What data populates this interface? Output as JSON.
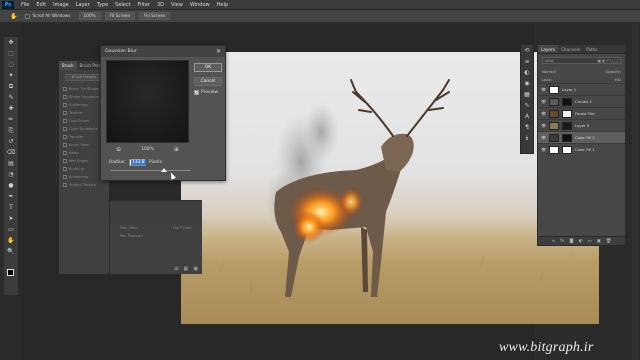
{
  "app": {
    "logo": "Ps"
  },
  "menu": [
    "File",
    "Edit",
    "Image",
    "Layer",
    "Type",
    "Select",
    "Filter",
    "3D",
    "View",
    "Window",
    "Help"
  ],
  "options": {
    "scroll_all_windows": "Scroll All Windows",
    "zoom_level": "100%",
    "fit_screen": "Fit Screen",
    "fill_screen": "Fill Screen"
  },
  "tools": [
    "move-tool-icon",
    "marquee-tool-icon",
    "lasso-tool-icon",
    "quick-select-icon",
    "crop-tool-icon",
    "eyedropper-icon",
    "healing-brush-icon",
    "brush-tool-icon",
    "clone-stamp-icon",
    "history-brush-icon",
    "eraser-icon",
    "gradient-icon",
    "blur-tool-icon",
    "dodge-tool-icon",
    "pen-tool-icon",
    "type-tool-icon",
    "path-select-icon",
    "shape-tool-icon",
    "hand-tool-icon",
    "zoom-tool-icon"
  ],
  "brush_panel": {
    "tabs": [
      "Brush",
      "Brush Pres"
    ],
    "presets_button": "Brush Presets",
    "items": [
      "Brush Tip Shape",
      "Shape Dynamics",
      "Scattering",
      "Texture",
      "Dual Brush",
      "Color Dynamics",
      "Transfer",
      "Brush Pose",
      "Noise",
      "Wet Edges",
      "Build-up",
      "Smoothing",
      "Protect Texture"
    ],
    "footer": {
      "left_top": "Size Jitter",
      "right_top": "Flip Y Jitter",
      "left_mid": "Pen Pressure",
      "right_mid": ""
    }
  },
  "gaussian_blur": {
    "title": "Gaussian Blur",
    "ok": "OK",
    "cancel": "Cancel",
    "preview_label": "Preview",
    "preview_checked": true,
    "zoom": "100%",
    "radius_label": "Radius:",
    "radius_value": "133.8",
    "radius_unit": "Pixels",
    "slider_fraction": 0.66
  },
  "layers_panel": {
    "tabs": [
      "Layers",
      "Channels",
      "Paths"
    ],
    "kind": "Kind",
    "blend_mode": "Normal",
    "opacity": "Opacity:",
    "lock": "Lock:",
    "fill": "Fill:",
    "layers": [
      {
        "name": "Layer 1",
        "thumb": "#ffffff",
        "mask": null,
        "selected": false
      },
      {
        "name": "Curves 1",
        "thumb": "#5a5a5a",
        "mask": "#111111",
        "selected": false
      },
      {
        "name": "Forest Fire",
        "thumb": "#6a4a2a",
        "mask": "#f2f2f2",
        "selected": false
      },
      {
        "name": "Layer 0",
        "thumb": "#8a7a5a",
        "mask": "#1a1a1a",
        "selected": false
      },
      {
        "name": "Color Fill 2",
        "thumb": "#3a3a3a",
        "mask": "#111111",
        "selected": true
      },
      {
        "name": "Color Fill 1",
        "thumb": "#ffffff",
        "mask": "#ffffff",
        "selected": false
      }
    ]
  },
  "watermark": "www.bitgraph.ir"
}
